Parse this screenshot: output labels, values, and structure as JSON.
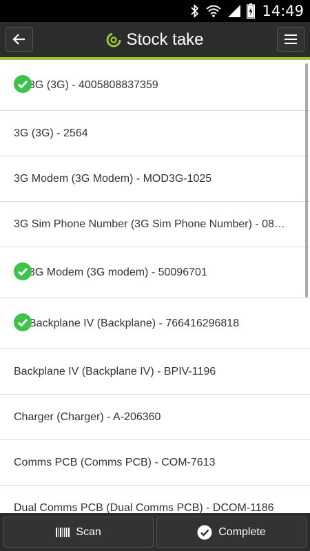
{
  "status_bar": {
    "time": "14:49",
    "icons": [
      "bluetooth-icon",
      "wifi-icon",
      "signal-icon",
      "battery-icon"
    ]
  },
  "header": {
    "title": "Stock take",
    "back_icon": "arrow-left-icon",
    "menu_icon": "hamburger-menu-icon",
    "accent_color": "#9dc23a",
    "bar_color": "#2c2c2c"
  },
  "items": [
    {
      "label": "3G (3G) - 4005808837359",
      "checked": true
    },
    {
      "label": "3G (3G) - 2564",
      "checked": false
    },
    {
      "label": "3G Modem (3G Modem) - MOD3G-1025",
      "checked": false
    },
    {
      "label": "3G Sim Phone Number (3G Sim Phone Number) - 08…",
      "checked": false
    },
    {
      "label": "3G Modem (3G modem) - 50096701",
      "checked": true
    },
    {
      "label": "Backplane IV (Backplane) - 766416296818",
      "checked": true
    },
    {
      "label": "Backplane IV (Backplane IV) - BPIV-1196",
      "checked": false
    },
    {
      "label": "Charger (Charger) - A-206360",
      "checked": false
    },
    {
      "label": "Comms PCB (Comms PCB) - COM-7613",
      "checked": false
    },
    {
      "label": "Dual Comms PCB (Dual Comms PCB) - DCOM-1186",
      "checked": false
    }
  ],
  "footer": {
    "scan_label": "Scan",
    "complete_label": "Complete"
  },
  "check_color": "#3cc34a"
}
